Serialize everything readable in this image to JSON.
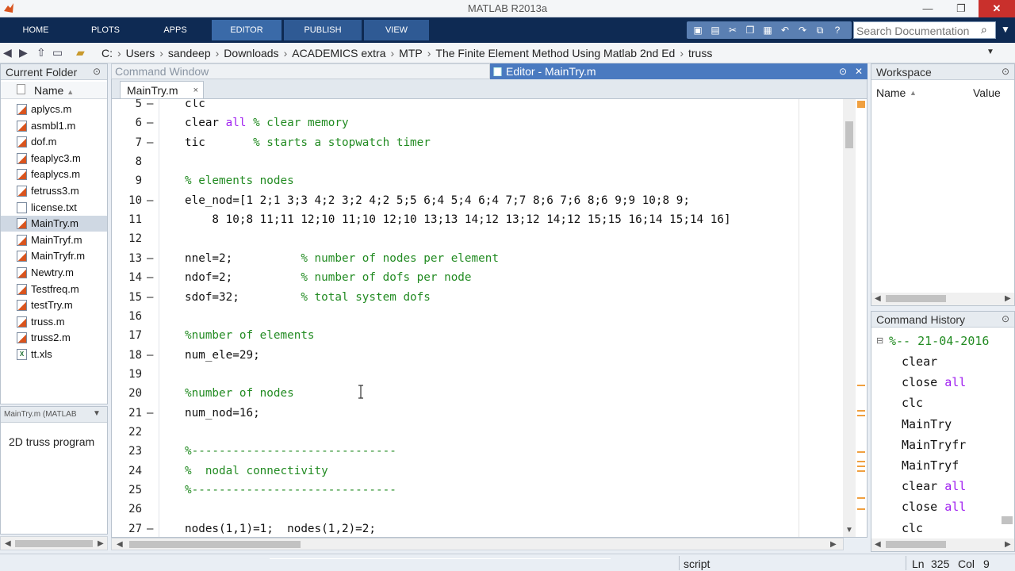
{
  "app": {
    "title": "MATLAB R2013a"
  },
  "window_controls": {
    "minimize": "—",
    "maximize": "❐",
    "close": "✕"
  },
  "ribbon": {
    "tabs": [
      "HOME",
      "PLOTS",
      "APPS",
      "EDITOR",
      "PUBLISH",
      "VIEW"
    ],
    "active_tab": "EDITOR",
    "search_placeholder": "Search Documentation"
  },
  "address": {
    "crumbs": [
      "C:",
      "Users",
      "sandeep",
      "Downloads",
      "ACADEMICS extra",
      "MTP",
      "The Finite Element Method Using Matlab 2nd Ed",
      "truss"
    ]
  },
  "current_folder": {
    "title": "Current Folder",
    "column": "Name",
    "files": [
      {
        "name": "aplycs.m",
        "selected": false
      },
      {
        "name": "asmbl1.m",
        "selected": false
      },
      {
        "name": "dof.m",
        "selected": false
      },
      {
        "name": "feaplyc3.m",
        "selected": false
      },
      {
        "name": "feaplycs.m",
        "selected": false
      },
      {
        "name": "fetruss3.m",
        "selected": false
      },
      {
        "name": "license.txt",
        "selected": false
      },
      {
        "name": "MainTry.m",
        "selected": true
      },
      {
        "name": "MainTryf.m",
        "selected": false
      },
      {
        "name": "MainTryfr.m",
        "selected": false
      },
      {
        "name": "Newtry.m",
        "selected": false
      },
      {
        "name": "Testfreq.m",
        "selected": false
      },
      {
        "name": "testTry.m",
        "selected": false
      },
      {
        "name": "truss.m",
        "selected": false
      },
      {
        "name": "truss2.m",
        "selected": false
      },
      {
        "name": "tt.xls",
        "selected": false
      }
    ],
    "details_header": "MainTry.m (MATLAB",
    "details_text": "2D truss program"
  },
  "command_window": {
    "title": "Command Window"
  },
  "editor": {
    "title": "Editor - MainTry.m",
    "tab": "MainTry.m",
    "lines": [
      {
        "n": "5",
        "dash": "—",
        "segs": [
          {
            "t": "clc",
            "c": "n"
          }
        ]
      },
      {
        "n": "6",
        "dash": "—",
        "segs": [
          {
            "t": "clear ",
            "c": "n"
          },
          {
            "t": "all",
            "c": "kw"
          },
          {
            "t": " % clear memory",
            "c": "cm"
          }
        ]
      },
      {
        "n": "7",
        "dash": "—",
        "segs": [
          {
            "t": "tic       ",
            "c": "n"
          },
          {
            "t": "% starts a stopwatch timer",
            "c": "cm"
          }
        ]
      },
      {
        "n": "8",
        "dash": "",
        "segs": []
      },
      {
        "n": "9",
        "dash": "",
        "segs": [
          {
            "t": "% elements nodes",
            "c": "cm"
          }
        ]
      },
      {
        "n": "10",
        "dash": "—",
        "segs": [
          {
            "t": "ele_nod=[1 2;1 3;3 4;2 3;2 4;2 5;5 6;4 5;4 6;4 7;7 8;6 7;6 8;6 9;9 10;8 9;",
            "c": "n"
          }
        ]
      },
      {
        "n": "11",
        "dash": "",
        "segs": [
          {
            "t": "    8 10;8 11;11 12;10 11;10 12;10 13;13 14;12 13;12 14;12 15;15 16;14 15;14 16]",
            "c": "n"
          }
        ]
      },
      {
        "n": "12",
        "dash": "",
        "segs": []
      },
      {
        "n": "13",
        "dash": "—",
        "segs": [
          {
            "t": "nnel=2;          ",
            "c": "n"
          },
          {
            "t": "% number of nodes per element",
            "c": "cm"
          }
        ]
      },
      {
        "n": "14",
        "dash": "—",
        "segs": [
          {
            "t": "ndof=2;          ",
            "c": "n"
          },
          {
            "t": "% number of dofs per node",
            "c": "cm"
          }
        ]
      },
      {
        "n": "15",
        "dash": "—",
        "segs": [
          {
            "t": "sdof=32;         ",
            "c": "n"
          },
          {
            "t": "% total system dofs",
            "c": "cm"
          }
        ]
      },
      {
        "n": "16",
        "dash": "",
        "segs": []
      },
      {
        "n": "17",
        "dash": "",
        "segs": [
          {
            "t": "%number of elements",
            "c": "cm"
          }
        ]
      },
      {
        "n": "18",
        "dash": "—",
        "segs": [
          {
            "t": "num_ele=29;",
            "c": "n"
          }
        ]
      },
      {
        "n": "19",
        "dash": "",
        "segs": []
      },
      {
        "n": "20",
        "dash": "",
        "segs": [
          {
            "t": "%number of nodes",
            "c": "cm"
          }
        ]
      },
      {
        "n": "21",
        "dash": "—",
        "segs": [
          {
            "t": "num_nod=16;",
            "c": "n"
          }
        ]
      },
      {
        "n": "22",
        "dash": "",
        "segs": []
      },
      {
        "n": "23",
        "dash": "",
        "segs": [
          {
            "t": "%------------------------------",
            "c": "cm"
          }
        ]
      },
      {
        "n": "24",
        "dash": "",
        "segs": [
          {
            "t": "%  nodal connectivity",
            "c": "cm"
          }
        ]
      },
      {
        "n": "25",
        "dash": "",
        "segs": [
          {
            "t": "%------------------------------",
            "c": "cm"
          }
        ]
      },
      {
        "n": "26",
        "dash": "",
        "segs": []
      },
      {
        "n": "27",
        "dash": "—",
        "segs": [
          {
            "t": "nodes(1,1)=1;  nodes(1,2)=2;",
            "c": "n"
          }
        ]
      }
    ]
  },
  "workspace": {
    "title": "Workspace",
    "col_name": "Name",
    "col_value": "Value"
  },
  "command_history": {
    "title": "Command History",
    "date": "%-- 21-04-2016",
    "entries": [
      {
        "cmd": "clear",
        "kw": ""
      },
      {
        "cmd": "close ",
        "kw": "all"
      },
      {
        "cmd": "clc",
        "kw": ""
      },
      {
        "cmd": "MainTry",
        "kw": ""
      },
      {
        "cmd": "MainTryfr",
        "kw": ""
      },
      {
        "cmd": "MainTryf",
        "kw": ""
      },
      {
        "cmd": "clear ",
        "kw": "all"
      },
      {
        "cmd": "close ",
        "kw": "all"
      },
      {
        "cmd": "clc",
        "kw": ""
      }
    ]
  },
  "status": {
    "mode": "script",
    "ln_label": "Ln",
    "ln": "325",
    "col_label": "Col",
    "col": "9"
  },
  "colors": {
    "ribbon": "#0e2a53",
    "active_tab": "#3a6aa8",
    "comment": "#228b22",
    "keyword": "#a020f0",
    "editor_head": "#4a7ac0"
  }
}
